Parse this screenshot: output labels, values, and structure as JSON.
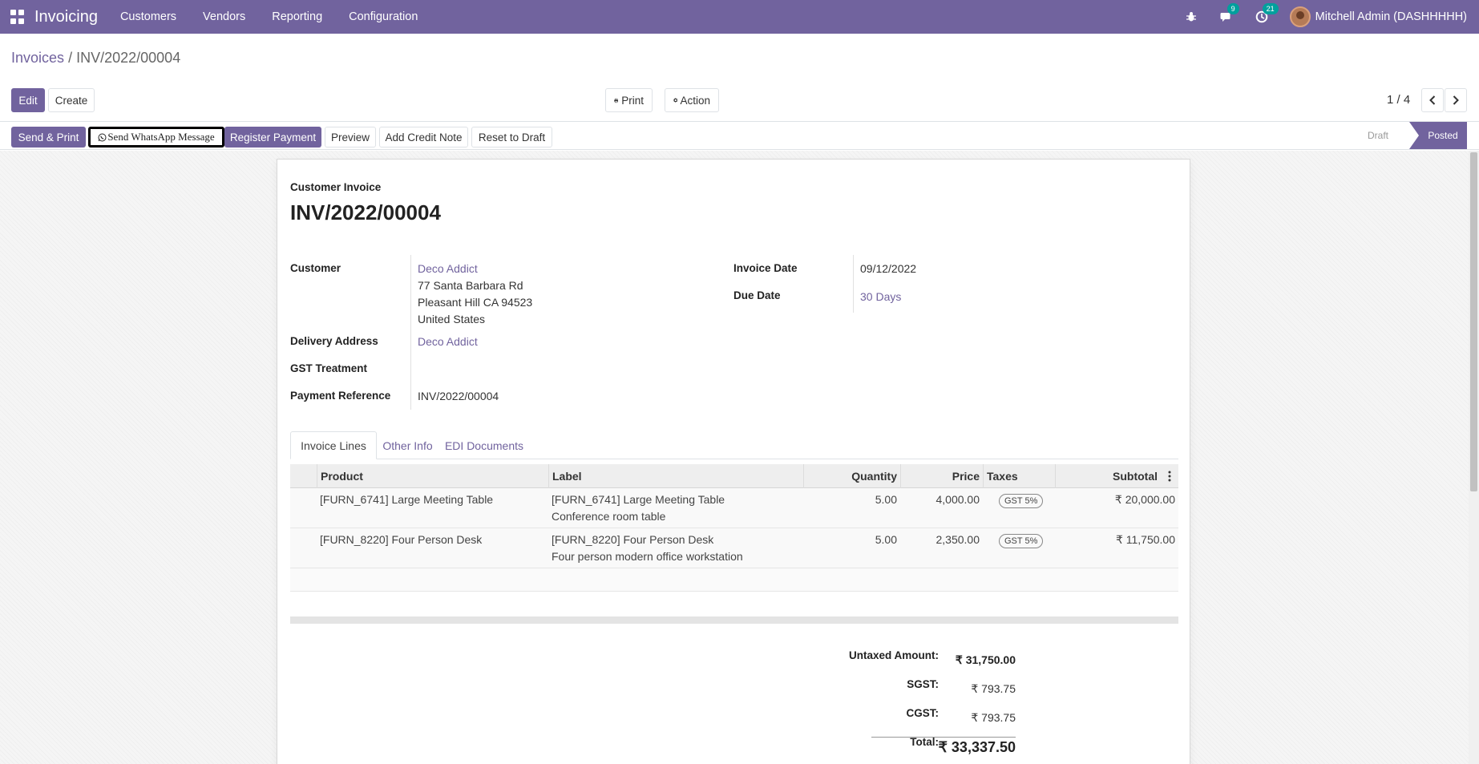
{
  "navbar": {
    "app_name": "Invoicing",
    "menu": [
      "Customers",
      "Vendors",
      "Reporting",
      "Configuration"
    ],
    "messages_count": "9",
    "activities_count": "21",
    "user": "Mitchell Admin (DASHHHHH)",
    "bg_color": "#71639e"
  },
  "breadcrumb": {
    "parent": "Invoices",
    "separator": "/",
    "current": "INV/2022/00004"
  },
  "controls": {
    "edit": "Edit",
    "create": "Create",
    "print": "Print",
    "action": "Action",
    "pager": "1 / 4"
  },
  "statusbar": {
    "send_print": "Send & Print",
    "whatsapp": "Send WhatsApp Message",
    "register_payment": "Register Payment",
    "preview": "Preview",
    "add_credit_note": "Add Credit Note",
    "reset_to_draft": "Reset to Draft",
    "states": [
      "Draft",
      "Posted"
    ],
    "active_state": "Posted"
  },
  "invoice": {
    "type": "Customer Invoice",
    "name": "INV/2022/00004",
    "customer_label": "Customer",
    "customer_name": "Deco Addict",
    "customer_address": [
      "77 Santa Barbara Rd",
      "Pleasant Hill CA 94523",
      "United States"
    ],
    "delivery_label": "Delivery Address",
    "delivery_value": "Deco Addict",
    "gst_label": "GST Treatment",
    "gst_value": "",
    "payment_ref_label": "Payment Reference",
    "payment_ref_value": "INV/2022/00004",
    "invoice_date_label": "Invoice Date",
    "invoice_date_value": "09/12/2022",
    "due_date_label": "Due Date",
    "due_date_value": "30 Days"
  },
  "tabs": [
    "Invoice Lines",
    "Other Info",
    "EDI Documents"
  ],
  "lines": {
    "headers": [
      "Product",
      "Label",
      "Quantity",
      "Price",
      "Taxes",
      "Subtotal"
    ],
    "rows": [
      {
        "product": "[FURN_6741] Large Meeting Table",
        "label_1": "[FURN_6741] Large Meeting Table",
        "label_2": "Conference room table",
        "quantity": "5.00",
        "price": "4,000.00",
        "tax": "GST 5%",
        "subtotal": "₹ 20,000.00"
      },
      {
        "product": "[FURN_8220] Four Person Desk",
        "label_1": "[FURN_8220] Four Person Desk",
        "label_2": "Four person modern office workstation",
        "quantity": "5.00",
        "price": "2,350.00",
        "tax": "GST 5%",
        "subtotal": "₹ 11,750.00"
      }
    ]
  },
  "totals": {
    "untaxed_label": "Untaxed Amount:",
    "untaxed_value": "₹ 31,750.00",
    "sgst_label": "SGST:",
    "sgst_value": "₹ 793.75",
    "cgst_label": "CGST:",
    "cgst_value": "₹ 793.75",
    "total_label": "Total:",
    "total_value": "₹ 33,337.50"
  }
}
